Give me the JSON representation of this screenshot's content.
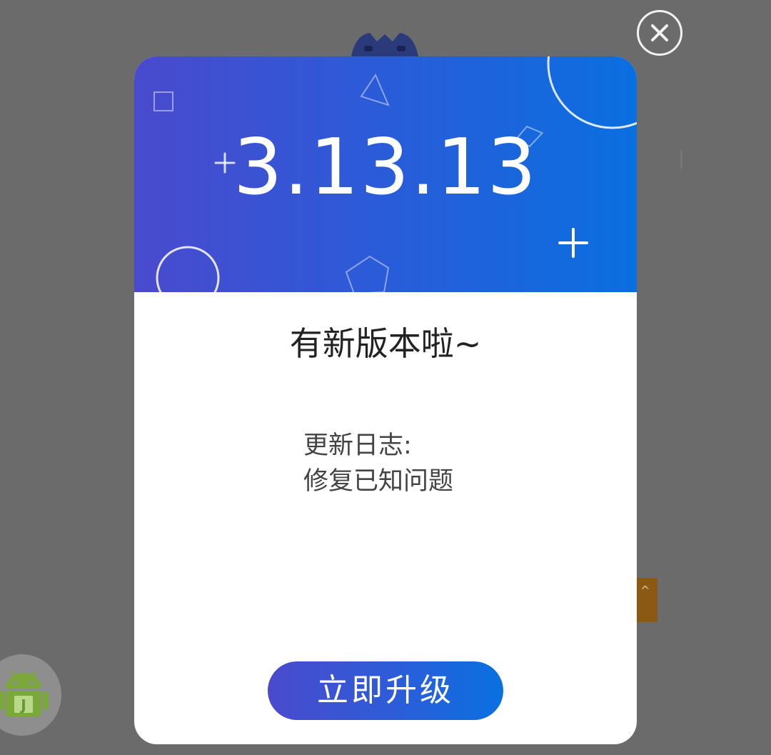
{
  "dialog": {
    "version": "3.13.13",
    "headline": "有新版本啦~",
    "changelog_title": "更新日志:",
    "changelog_items": [
      "修复已知问题"
    ],
    "upgrade_button_label": "立即升级",
    "close_icon": "close-circle-icon"
  },
  "background": {
    "side_tab_glyph": "^",
    "floating_badge_icon": "android-icon"
  },
  "colors": {
    "overlay": "#6b6b6b",
    "gradient_start": "#4a4acd",
    "gradient_end": "#0a6fe0",
    "dialog_bg": "#ffffff",
    "headline_text": "#222222",
    "body_text": "#444444"
  }
}
